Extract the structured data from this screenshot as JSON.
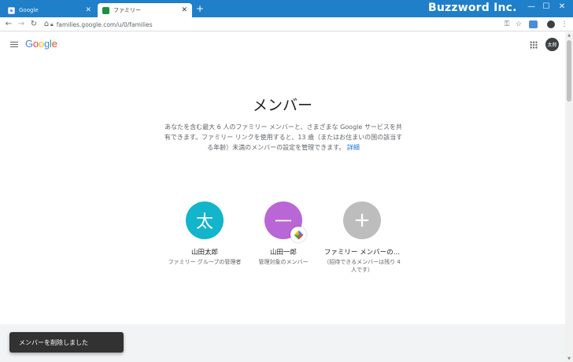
{
  "browser": {
    "tabs": [
      {
        "title": "Google",
        "close": "✕"
      },
      {
        "title": "ファミリー",
        "close": "✕"
      }
    ],
    "new_tab": "+",
    "brand": "Buzzword Inc.",
    "window_controls": {
      "minimize": "—",
      "maximize": "☐",
      "close": "✕"
    },
    "nav": {
      "back": "←",
      "forward": "→",
      "reload": "↻",
      "home": "⌂"
    },
    "url": "families.google.com/u/0/families",
    "toolbar_icons": {
      "key": "⚿",
      "star": "☆",
      "menu": "⋮"
    }
  },
  "header": {
    "logo_letters": [
      {
        "char": "G",
        "color": "#4285f4"
      },
      {
        "char": "o",
        "color": "#ea4335"
      },
      {
        "char": "o",
        "color": "#fbbc05"
      },
      {
        "char": "g",
        "color": "#4285f4"
      },
      {
        "char": "l",
        "color": "#34a853"
      },
      {
        "char": "e",
        "color": "#ea4335"
      }
    ],
    "avatar_text": "太郎"
  },
  "main": {
    "title": "メンバー",
    "description": "あなたを含む最大 6 人のファミリー メンバーと、さまざまな Google サービスを共有できます。ファミリー リンクを使用すると、13 歳（またはお住まいの国の該当する年齢）未満のメンバーの設定を管理できます。",
    "details_link": "詳細",
    "members": [
      {
        "initial": "太",
        "name": "山田太郎",
        "role": "ファミリー グループの管理者",
        "color": "#12b5cb"
      },
      {
        "initial": "一",
        "name": "山田一郎",
        "role": "管理対象のメンバー",
        "color": "#b966d6"
      },
      {
        "initial": "+",
        "name": "ファミリー メンバーの…",
        "role": "（招待できるメンバーは残り 4 人です）",
        "color": "#bdbdbd"
      }
    ]
  },
  "snackbar": {
    "message": "メンバーを削除しました"
  }
}
